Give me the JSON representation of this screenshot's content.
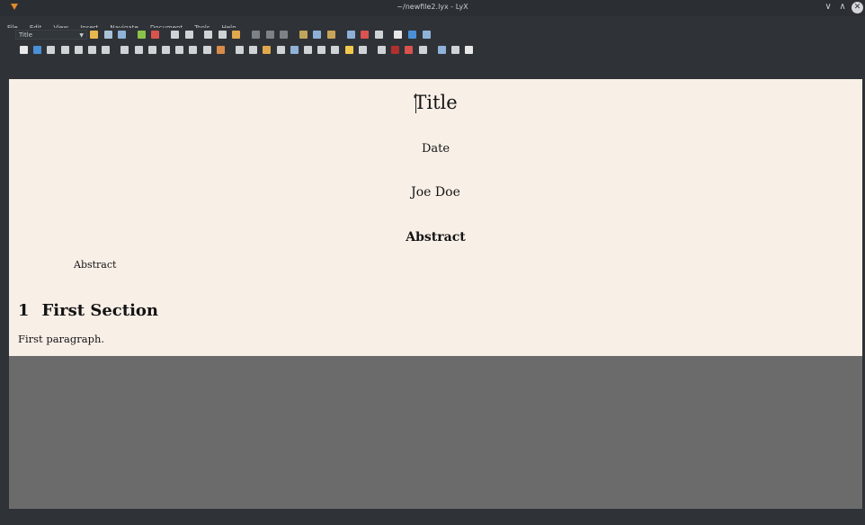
{
  "window": {
    "title": "~/newfile2.lyx - LyX"
  },
  "menubar": {
    "items": [
      "File",
      "Edit",
      "View",
      "Insert",
      "Navigate",
      "Document",
      "Tools",
      "Help"
    ]
  },
  "toolbar": {
    "layout_value": "Title",
    "row1": [
      {
        "icon": "new-document-icon",
        "color": "#e8b64c"
      },
      {
        "icon": "open-icon",
        "color": "#a9c2d6"
      },
      {
        "icon": "save-icon",
        "color": "#8fb2d9"
      },
      {
        "icon": "spellcheck-icon",
        "color": "#8bc34a"
      },
      {
        "icon": "track-changes-icon",
        "color": "#d9534f"
      },
      {
        "icon": "undo-icon",
        "color": "#cfd3d6"
      },
      {
        "icon": "redo-icon",
        "color": "#cfd3d6"
      },
      {
        "icon": "cut-icon",
        "color": "#cfd3d6"
      },
      {
        "icon": "copy-icon",
        "color": "#cfd3d6"
      },
      {
        "icon": "paste-icon",
        "color": "#e0a84c"
      },
      {
        "icon": "search-icon",
        "color": "#7d8287"
      },
      {
        "icon": "find-replace-icon",
        "color": "#7d8287"
      },
      {
        "icon": "back-arrow-icon",
        "color": "#7d8287"
      },
      {
        "icon": "emphasis-icon",
        "color": "#c0a55a"
      },
      {
        "icon": "noun-icon",
        "color": "#8eb0d8"
      },
      {
        "icon": "text-style-icon",
        "color": "#c6a45a"
      },
      {
        "icon": "math-sum-icon",
        "color": "#8eb0d8"
      },
      {
        "icon": "insert-graphics-icon",
        "color": "#d9534f"
      },
      {
        "icon": "table-icon",
        "color": "#cfd3d6"
      },
      {
        "icon": "view-pdf-icon",
        "color": "#e8e8e8"
      },
      {
        "icon": "update-view-icon",
        "color": "#4a90d9"
      },
      {
        "icon": "toggle-toolbar-icon",
        "color": "#8fb2d9"
      }
    ],
    "row2": [
      {
        "icon": "quote-icon",
        "color": "#e8e8e8"
      },
      {
        "icon": "refresh-icon",
        "color": "#4a90d9"
      },
      {
        "icon": "toc-icon",
        "color": "#cfd3d6"
      },
      {
        "icon": "index-icon",
        "color": "#cfd3d6"
      },
      {
        "icon": "citation-icon",
        "color": "#cfd3d6"
      },
      {
        "icon": "label-icon",
        "color": "#cfd3d6"
      },
      {
        "icon": "reference-icon",
        "color": "#cfd3d6"
      },
      {
        "icon": "align-left-icon",
        "color": "#cfd3d6"
      },
      {
        "icon": "align-center-icon",
        "color": "#cfd3d6"
      },
      {
        "icon": "align-right-icon",
        "color": "#cfd3d6"
      },
      {
        "icon": "align-block-icon",
        "color": "#cfd3d6"
      },
      {
        "icon": "indent-icon",
        "color": "#cfd3d6"
      },
      {
        "icon": "outdent-icon",
        "color": "#cfd3d6"
      },
      {
        "icon": "list-icon",
        "color": "#cfd3d6"
      },
      {
        "icon": "image-icon",
        "color": "#d88c4a"
      },
      {
        "icon": "box-icon",
        "color": "#cfd3d6"
      },
      {
        "icon": "tag-icon",
        "color": "#cfd3d6"
      },
      {
        "icon": "note-icon",
        "color": "#e0a84c"
      },
      {
        "icon": "edit-icon",
        "color": "#cfd3d6"
      },
      {
        "icon": "bookmark-icon",
        "color": "#8fb2d9"
      },
      {
        "icon": "comment-icon",
        "color": "#cfd3d6"
      },
      {
        "icon": "document-icon",
        "color": "#cfd3d6"
      },
      {
        "icon": "page-icon",
        "color": "#cfd3d6"
      },
      {
        "icon": "sticky-note-icon",
        "color": "#f2c94c"
      },
      {
        "icon": "info-icon",
        "color": "#cfd3d6"
      },
      {
        "icon": "settings-icon",
        "color": "#cfd3d6"
      },
      {
        "icon": "marker-icon",
        "color": "#b03030"
      },
      {
        "icon": "error-icon",
        "color": "#d9534f"
      },
      {
        "icon": "attachment-icon",
        "color": "#cfd3d6"
      },
      {
        "icon": "preferences-icon",
        "color": "#8fb2d9"
      },
      {
        "icon": "help-icon",
        "color": "#cfd3d6"
      },
      {
        "icon": "book-icon",
        "color": "#e8e8e8"
      }
    ]
  },
  "document": {
    "title": "Title",
    "date": "Date",
    "author": "Joe Doe",
    "abstract_heading": "Abstract",
    "abstract_body": "Abstract",
    "section_number": "1",
    "section_title": "First Section",
    "paragraph": "First paragraph."
  },
  "colors": {
    "page": "#f8efe7",
    "workspace": "#6b6b6b",
    "chrome": "#2f3337"
  }
}
